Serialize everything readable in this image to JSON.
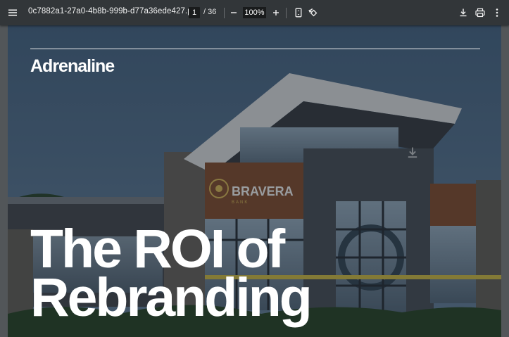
{
  "toolbar": {
    "filename": "0c7882a1-27a0-4b8b-999b-d77a36ede427.pdf",
    "current_page": "1",
    "page_total": "/ 36",
    "zoom": "100%",
    "icons": {
      "menu": "menu-icon",
      "zoom_out": "minus-icon",
      "zoom_in": "plus-icon",
      "fit": "fit-page-icon",
      "rotate": "rotate-icon",
      "download": "download-icon",
      "print": "print-icon",
      "more": "more-vertical-icon"
    }
  },
  "document": {
    "brand": "Adrenaline",
    "headline_line1": "The ROI of",
    "headline_line2": "Rebranding",
    "sign_name": "BRAVERA",
    "sign_sub": "BANK"
  },
  "colors": {
    "toolbar_bg": "#323639",
    "viewer_bg": "#525659",
    "text_white": "#ffffff"
  }
}
